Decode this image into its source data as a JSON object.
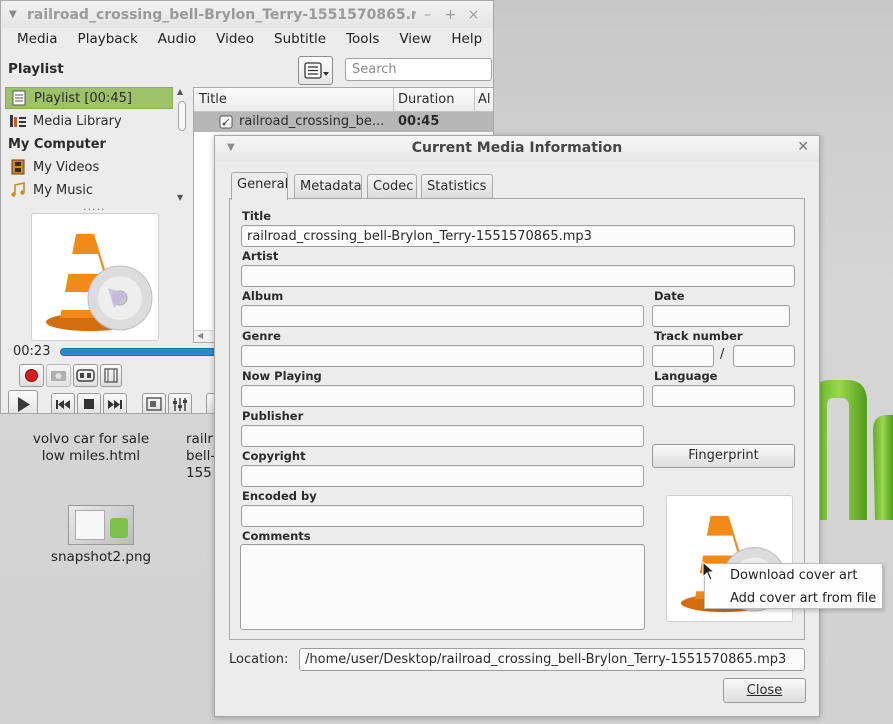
{
  "desktop": {
    "icons": [
      {
        "label_line1": "volvo car for sale",
        "label_line2": "low miles.html"
      },
      {
        "label_line1": "railr",
        "label_line2": "bell-",
        "label_line3": "155"
      },
      {
        "label": "snapshot2.png"
      }
    ]
  },
  "vlc": {
    "title": "railroad_crossing_bell-Brylon_Terry-1551570865.r",
    "title_controls": [
      "–",
      "+",
      "×"
    ],
    "menu": [
      "Media",
      "Playback",
      "Audio",
      "Video",
      "Subtitle",
      "Tools",
      "View",
      "Help"
    ],
    "playlist_label": "Playlist",
    "search_placeholder": "Search",
    "sidebar": {
      "playlist_item": "Playlist [00:45]",
      "media_library": "Media Library",
      "my_computer": "My Computer",
      "my_videos": "My Videos",
      "my_music": "My Music"
    },
    "table": {
      "columns": [
        "Title",
        "Duration",
        "Al"
      ],
      "rows": [
        {
          "title": "railroad_crossing_be...",
          "duration": "00:45"
        }
      ]
    },
    "elapsed": "00:23",
    "progress": 0.51
  },
  "dialog": {
    "title": "Current Media Information",
    "tabs": [
      "General",
      "Metadata",
      "Codec",
      "Statistics"
    ],
    "active_tab": "General",
    "fields": {
      "title_label": "Title",
      "title_value": "railroad_crossing_bell-Brylon_Terry-1551570865.mp3",
      "artist_label": "Artist",
      "album_label": "Album",
      "date_label": "Date",
      "genre_label": "Genre",
      "track_label": "Track number",
      "track_sep": "/",
      "now_playing_label": "Now Playing",
      "language_label": "Language",
      "publisher_label": "Publisher",
      "copyright_label": "Copyright",
      "encoded_by_label": "Encoded by",
      "comments_label": "Comments"
    },
    "fingerprint_button": "Fingerprint",
    "location_label": "Location:",
    "location_value": "/home/user/Desktop/railroad_crossing_bell-Brylon_Terry-1551570865.mp3",
    "close_button": "Close"
  },
  "context_menu": {
    "items": [
      "Download cover art",
      "Add cover art from file"
    ]
  },
  "colors": {
    "selection": "#9dc26a",
    "seek": "#2d8ac8",
    "cone_orange": "#f28a1a"
  }
}
